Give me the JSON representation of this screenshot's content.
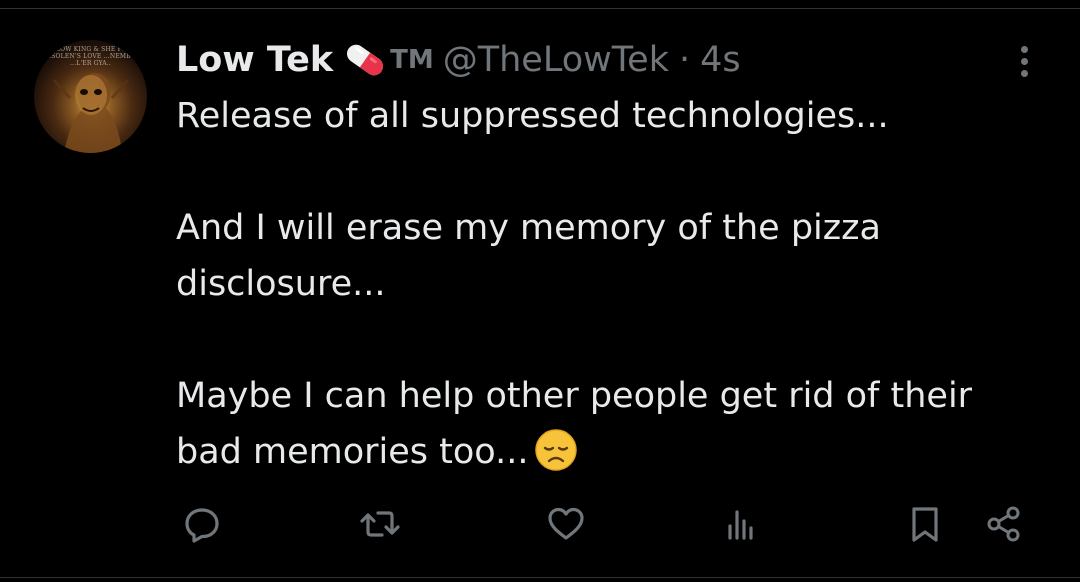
{
  "tweet": {
    "author": {
      "display_name": "Low Tek",
      "badge_icon": "pill-icon",
      "tm_text": "TM",
      "handle": "@TheLowTek",
      "separator": "·",
      "timestamp": "4s",
      "avatar_text": [
        "...L LOW KING & SHE FUL...",
        "...SOLEN'S LOVE ...NEMBO",
        "...L'ER GYA.."
      ]
    },
    "body": {
      "line1": "Release of all suppressed technologies...",
      "line2": "And I will erase my memory of the pizza",
      "line3": "disclosure...",
      "line4": "Maybe I can help other people get rid of their",
      "line5": "bad memories too...",
      "emoji": "disappointed-face"
    },
    "actions": {
      "reply": "reply-icon",
      "repost": "repost-icon",
      "like": "like-icon",
      "views": "views-icon",
      "bookmark": "bookmark-icon",
      "share": "share-icon",
      "more": "more-options-icon"
    }
  },
  "colors": {
    "background": "#000000",
    "primary_text": "#e7e9ea",
    "secondary_text": "#71767b",
    "divider": "#2f3336"
  }
}
